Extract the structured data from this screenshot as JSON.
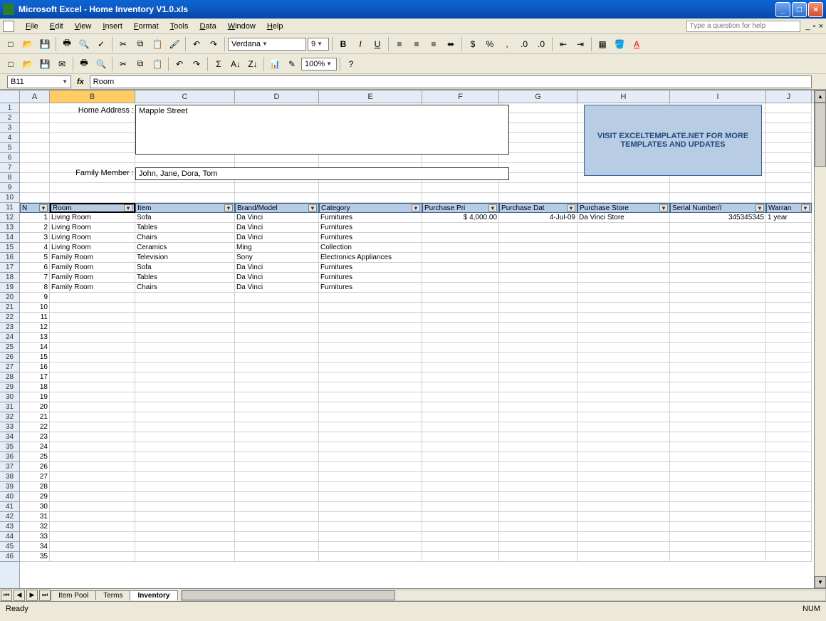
{
  "title": "Microsoft Excel - Home Inventory V1.0.xls",
  "menubar": [
    "File",
    "Edit",
    "View",
    "Insert",
    "Format",
    "Tools",
    "Data",
    "Window",
    "Help"
  ],
  "question_placeholder": "Type a question for help",
  "font_name": "Verdana",
  "font_size": "9",
  "zoom": "100%",
  "name_box": "B11",
  "formula_value": "Room",
  "columns": [
    "A",
    "B",
    "C",
    "D",
    "E",
    "F",
    "G",
    "H",
    "I",
    "J"
  ],
  "labels": {
    "home_address": "Home Address :",
    "family_member": "Family Member :"
  },
  "home_address": "Mapple Street",
  "family_member": "John, Jane, Dora, Tom",
  "banner": "VISIT EXCELTEMPLATE.NET FOR MORE TEMPLATES AND UPDATES",
  "table_headers": [
    "N",
    "Room",
    "Item",
    "Brand/Model",
    "Category",
    "Purchase Pri",
    "Purchase Dat",
    "Purchase Store",
    "Serial Number/I",
    "Warran"
  ],
  "rows": [
    {
      "n": "1",
      "room": "Living Room",
      "item": "Sofa",
      "brand": "Da Vinci",
      "cat": "Furnitures",
      "price": "$       4,000.00",
      "date": "4-Jul-09",
      "store": "Da Vinci Store",
      "serial": "345345345",
      "warr": "1 year"
    },
    {
      "n": "2",
      "room": "Living Room",
      "item": "Tables",
      "brand": "Da Vinci",
      "cat": "Furnitures",
      "price": "",
      "date": "",
      "store": "",
      "serial": "",
      "warr": ""
    },
    {
      "n": "3",
      "room": "Living Room",
      "item": "Chairs",
      "brand": "Da Vinci",
      "cat": "Furnitures",
      "price": "",
      "date": "",
      "store": "",
      "serial": "",
      "warr": ""
    },
    {
      "n": "4",
      "room": "Living Room",
      "item": "Ceramics",
      "brand": "Ming",
      "cat": "Collection",
      "price": "",
      "date": "",
      "store": "",
      "serial": "",
      "warr": ""
    },
    {
      "n": "5",
      "room": "Family Room",
      "item": "Television",
      "brand": "Sony",
      "cat": "Electronics Appliances",
      "price": "",
      "date": "",
      "store": "",
      "serial": "",
      "warr": ""
    },
    {
      "n": "6",
      "room": "Family Room",
      "item": "Sofa",
      "brand": "Da Vinci",
      "cat": "Furnitures",
      "price": "",
      "date": "",
      "store": "",
      "serial": "",
      "warr": ""
    },
    {
      "n": "7",
      "room": "Family Room",
      "item": "Tables",
      "brand": "Da Vinci",
      "cat": "Furnitures",
      "price": "",
      "date": "",
      "store": "",
      "serial": "",
      "warr": ""
    },
    {
      "n": "8",
      "room": "Family Room",
      "item": "Chairs",
      "brand": "Da Vinci",
      "cat": "Furnitures",
      "price": "",
      "date": "",
      "store": "",
      "serial": "",
      "warr": ""
    }
  ],
  "empty_nums": [
    "9",
    "10",
    "11",
    "12",
    "13",
    "14",
    "15",
    "16",
    "17",
    "18",
    "19",
    "20",
    "21",
    "22",
    "23",
    "24",
    "25",
    "26",
    "27",
    "28",
    "29",
    "30",
    "31",
    "32",
    "33",
    "34",
    "35"
  ],
  "row_numbers_top": [
    "1",
    "2",
    "3",
    "4",
    "5",
    "6",
    "7",
    "8",
    "9",
    "10"
  ],
  "row_numbers_data": [
    "11",
    "12",
    "13",
    "14",
    "15",
    "16",
    "17",
    "18",
    "19",
    "20",
    "21",
    "22",
    "23",
    "24",
    "25",
    "26",
    "27",
    "28",
    "29",
    "30",
    "31",
    "32",
    "33",
    "34",
    "35",
    "36",
    "37",
    "38",
    "39",
    "40",
    "41",
    "42",
    "43",
    "44",
    "45",
    "46"
  ],
  "sheet_tabs": [
    "Item Pool",
    "Terms",
    "Inventory"
  ],
  "active_tab": 2,
  "status": "Ready",
  "status_right": "NUM"
}
